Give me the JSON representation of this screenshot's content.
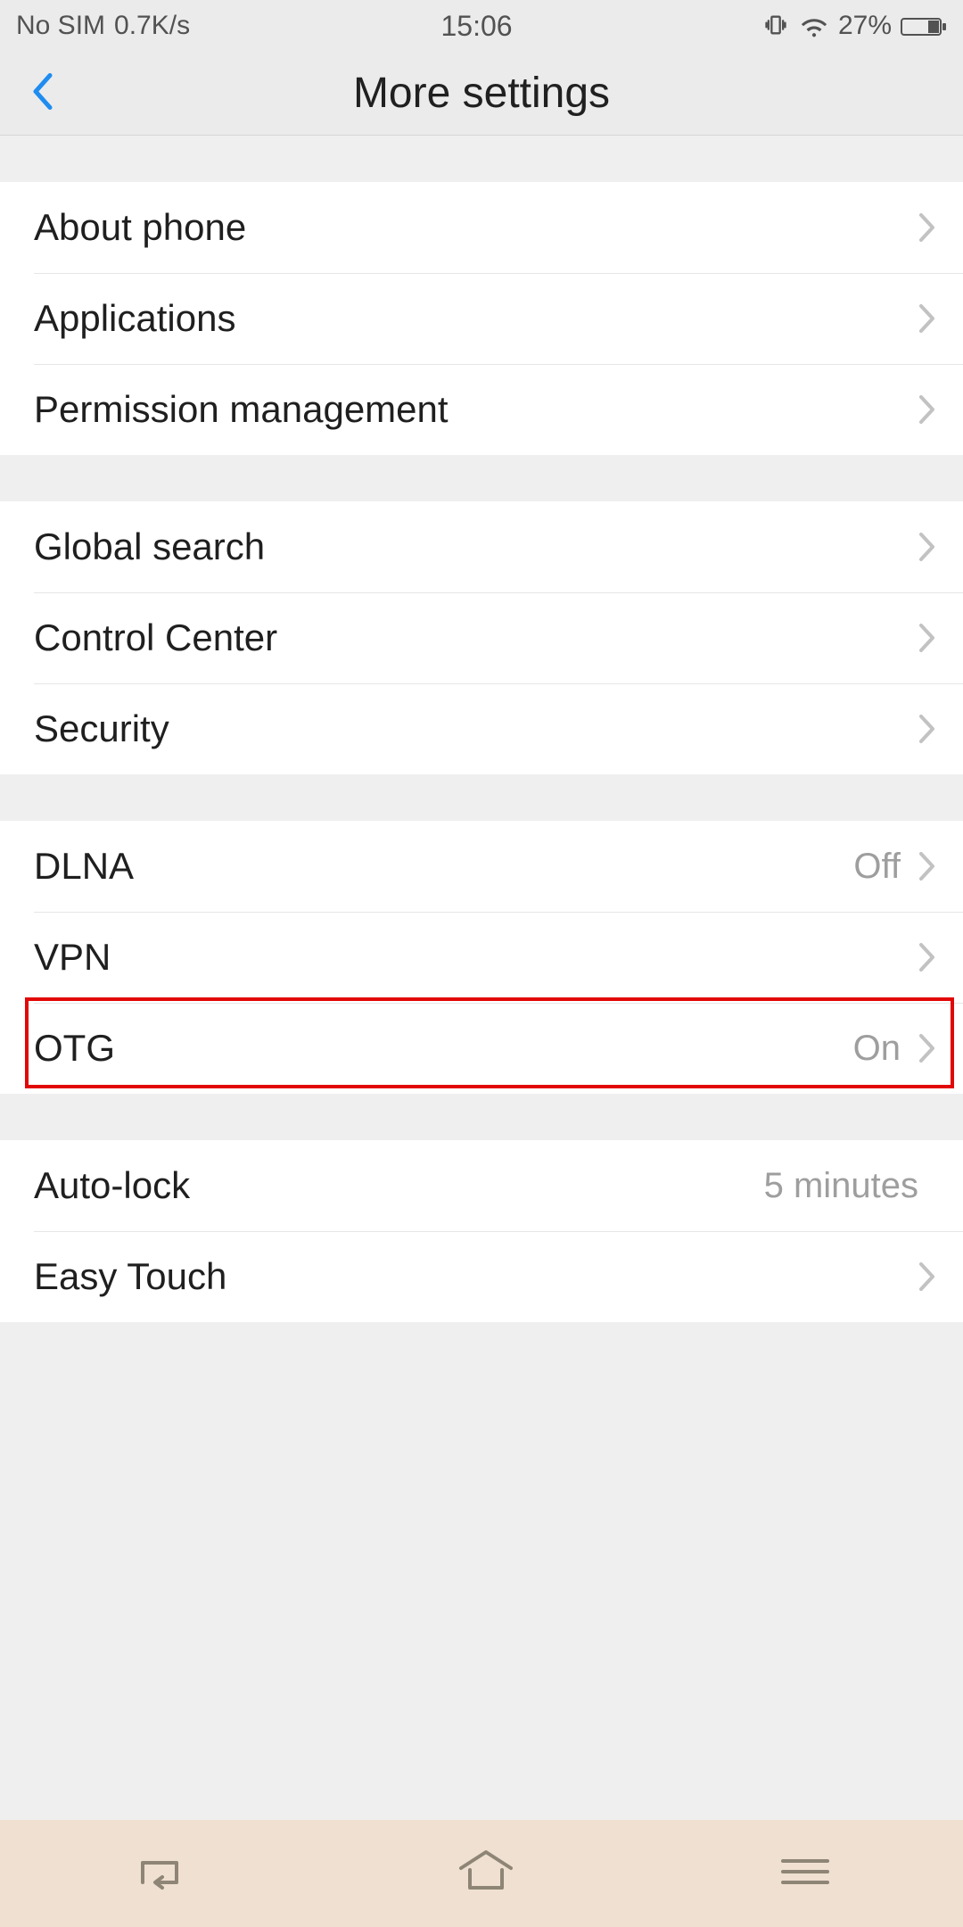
{
  "statusbar": {
    "sim": "No SIM",
    "speed": "0.7K/s",
    "time": "15:06",
    "battery_pct": "27%"
  },
  "header": {
    "title": "More settings"
  },
  "groups": [
    {
      "items": [
        {
          "label": "About phone",
          "value": ""
        },
        {
          "label": "Applications",
          "value": ""
        },
        {
          "label": "Permission management",
          "value": ""
        }
      ]
    },
    {
      "items": [
        {
          "label": "Global search",
          "value": ""
        },
        {
          "label": "Control Center",
          "value": ""
        },
        {
          "label": "Security",
          "value": ""
        }
      ]
    },
    {
      "items": [
        {
          "label": "DLNA",
          "value": "Off"
        },
        {
          "label": "VPN",
          "value": ""
        },
        {
          "label": "OTG",
          "value": "On"
        }
      ]
    },
    {
      "items": [
        {
          "label": "Auto-lock",
          "value": "5 minutes"
        },
        {
          "label": "Easy Touch",
          "value": ""
        }
      ]
    }
  ]
}
